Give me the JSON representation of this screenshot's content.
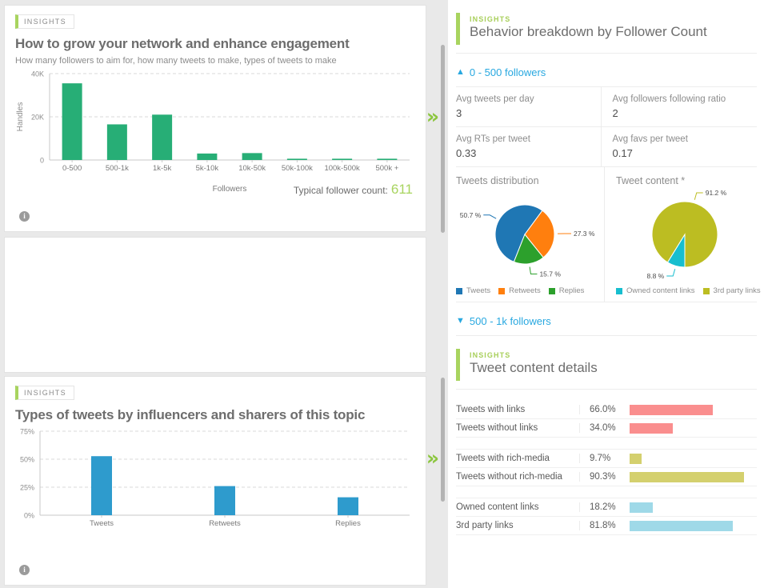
{
  "left": {
    "cards": [
      {
        "badge": "INSIGHTS",
        "title": "How to grow your network and enhance engagement",
        "subtitle": "How many followers to aim for, how many tweets to make, types of tweets to make",
        "footer_label": "Typical follower count:",
        "footer_value": "611",
        "info_icon": "info-icon"
      },
      {
        "badge": "INSIGHTS",
        "title": "Types of tweets by influencers and sharers of this topic",
        "info_icon": "info-icon"
      }
    ],
    "next_icon": "double-chevron-right-icon"
  },
  "right": {
    "panel1": {
      "kicker": "INSIGHTS",
      "title": "Behavior breakdown by Follower Count"
    },
    "accordion_open": {
      "label": "0 - 500 followers",
      "caret": "chevron-up-icon"
    },
    "accordion_closed": {
      "label": "500 - 1k followers",
      "caret": "chevron-down-icon"
    },
    "metrics": [
      [
        {
          "label": "Avg tweets per day",
          "value": "3"
        },
        {
          "label": "Avg followers following ratio",
          "value": "2"
        }
      ],
      [
        {
          "label": "Avg RTs per tweet",
          "value": "0.33"
        },
        {
          "label": "Avg favs per tweet",
          "value": "0.17"
        }
      ]
    ],
    "panel2": {
      "kicker": "INSIGHTS",
      "title": "Tweet content details"
    }
  },
  "chart_data": [
    {
      "type": "bar",
      "title": "How to grow your network and enhance engagement",
      "categories": [
        "0-500",
        "500-1k",
        "1k-5k",
        "5k-10k",
        "10k-50k",
        "50k-100k",
        "100k-500k",
        "500k +"
      ],
      "values": [
        35500,
        16500,
        21000,
        3000,
        3200,
        350,
        320,
        300
      ],
      "xlabel": "Followers",
      "ylabel": "Handles",
      "ylim": [
        0,
        40000
      ],
      "yticks": [
        0,
        20000,
        40000
      ],
      "ytick_labels": [
        "0",
        "20K",
        "40K"
      ],
      "grid": true,
      "color": "#27ae76"
    },
    {
      "type": "pie",
      "title": "Tweets distribution",
      "labels": [
        "Tweets",
        "Retweets",
        "Replies"
      ],
      "values": [
        50.7,
        27.3,
        15.7
      ],
      "value_labels": [
        "50.7 %",
        "27.3 %",
        "15.7 %"
      ],
      "colors": [
        "#1f77b4",
        "#ff7f0e",
        "#2ca02c"
      ],
      "legend": "bottom"
    },
    {
      "type": "pie",
      "title": "Tweet content *",
      "labels": [
        "Owned content links",
        "3rd party links"
      ],
      "values": [
        8.8,
        91.2
      ],
      "value_labels": [
        "8.8 %",
        "91.2 %"
      ],
      "colors": [
        "#17becf",
        "#bcbd22"
      ],
      "legend": "bottom"
    },
    {
      "type": "bar",
      "title": "Types of tweets by influencers and sharers of this topic",
      "categories": [
        "Tweets",
        "Retweets",
        "Replies"
      ],
      "values": [
        52.7,
        26.0,
        16.0
      ],
      "xlabel": "",
      "ylabel": "",
      "ylim": [
        0,
        75
      ],
      "yticks": [
        0,
        25,
        50,
        75
      ],
      "ytick_labels": [
        "0%",
        "25%",
        "50%",
        "75%"
      ],
      "grid": true,
      "color": "#2e9bcd"
    },
    {
      "type": "table",
      "title": "Tweet content details",
      "groups": [
        {
          "rows": [
            {
              "label": "Tweets with links",
              "pct": "66.0%",
              "value": 66.0,
              "color": "#fa8e8e"
            },
            {
              "label": "Tweets without links",
              "pct": "34.0%",
              "value": 34.0,
              "color": "#fa8e8e"
            }
          ]
        },
        {
          "rows": [
            {
              "label": "Tweets with rich-media",
              "pct": "9.7%",
              "value": 9.7,
              "color": "#d4d06e"
            },
            {
              "label": "Tweets without rich-media",
              "pct": "90.3%",
              "value": 90.3,
              "color": "#d4d06e"
            }
          ]
        },
        {
          "rows": [
            {
              "label": "Owned content links",
              "pct": "18.2%",
              "value": 18.2,
              "color": "#9fd9e8"
            },
            {
              "label": "3rd party links",
              "pct": "81.8%",
              "value": 81.8,
              "color": "#9fd9e8"
            }
          ]
        }
      ]
    }
  ]
}
